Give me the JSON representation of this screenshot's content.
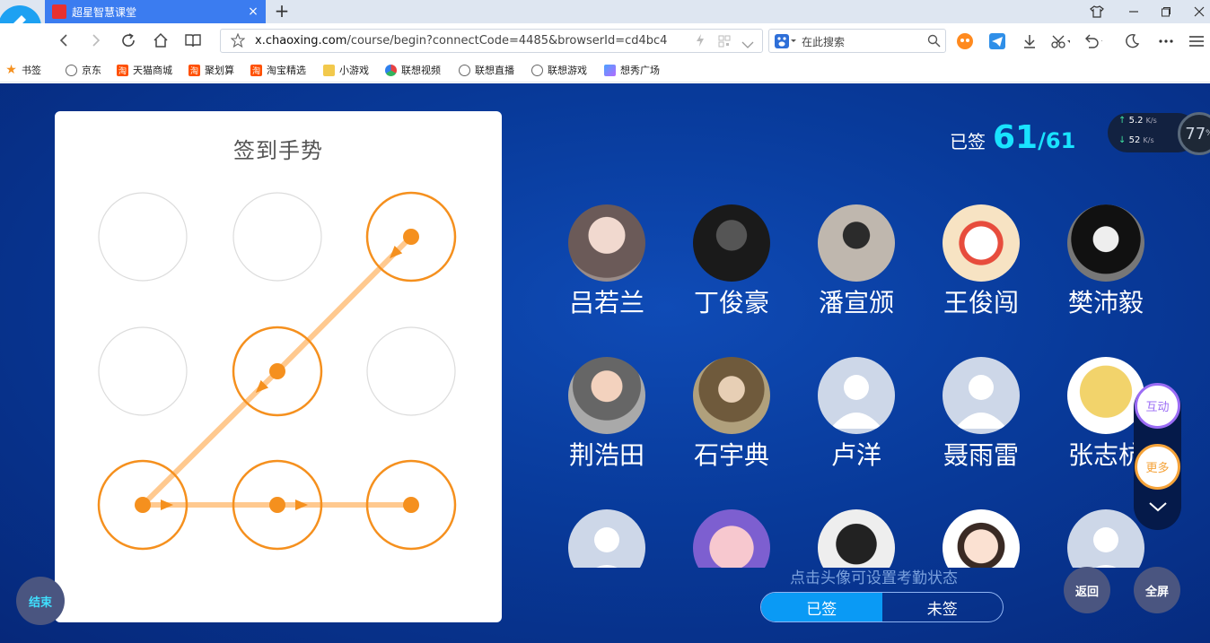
{
  "browser": {
    "tab_title": "超星智慧课堂",
    "tab_close": "×",
    "new_tab": "+",
    "url_domain": "x.chaoxing.com",
    "url_path": "/course/begin?connectCode=4485&browserId=cd4bc4",
    "search_placeholder": "在此搜索",
    "bookmarks": [
      "书签",
      "京东",
      "天猫商城",
      "聚划算",
      "淘宝精选",
      "小游戏",
      "联想视频",
      "联想直播",
      "联想游戏",
      "想秀广场"
    ]
  },
  "gesture": {
    "title": "签到手势",
    "pattern_nodes": [
      3,
      5,
      7,
      8,
      9
    ]
  },
  "attendance": {
    "signed_label": "已签",
    "signed_count": "61",
    "total": "/61",
    "hint": "点击头像可设置考勤状态",
    "tab_signed": "已签",
    "tab_unsigned": "未签"
  },
  "students": [
    {
      "name": "吕若兰",
      "avatar": "photo-anime-girl"
    },
    {
      "name": "丁俊豪",
      "avatar": "photo-dark"
    },
    {
      "name": "潘宣颁",
      "avatar": "photo-child"
    },
    {
      "name": "王俊闯",
      "avatar": "photo-badge"
    },
    {
      "name": "樊沛毅",
      "avatar": "photo-woman"
    },
    {
      "name": "荆浩田",
      "avatar": "photo-baby"
    },
    {
      "name": "石宇典",
      "avatar": "photo-girl"
    },
    {
      "name": "卢洋",
      "avatar": "default-avatar"
    },
    {
      "name": "聂雨雷",
      "avatar": "default-avatar"
    },
    {
      "name": "张志杭",
      "avatar": "photo-doge"
    },
    {
      "name": "",
      "avatar": "default-avatar"
    },
    {
      "name": "",
      "avatar": "photo-cartoon"
    },
    {
      "name": "",
      "avatar": "photo-masked"
    },
    {
      "name": "",
      "avatar": "photo-sticker"
    },
    {
      "name": "",
      "avatar": "default-avatar"
    }
  ],
  "network": {
    "upload": "5.2",
    "upload_unit": "K/s",
    "download": "52",
    "download_unit": "K/s",
    "cpu": "77",
    "cpu_unit": "%"
  },
  "controls": {
    "end": "结束",
    "interact": "互动",
    "more": "更多",
    "back": "返回",
    "fullscreen": "全屏"
  },
  "colors": {
    "accent": "#f5901e",
    "pattern_line": "#ffc98f",
    "count": "#19e3ff",
    "active_tab": "#0a9af5"
  }
}
